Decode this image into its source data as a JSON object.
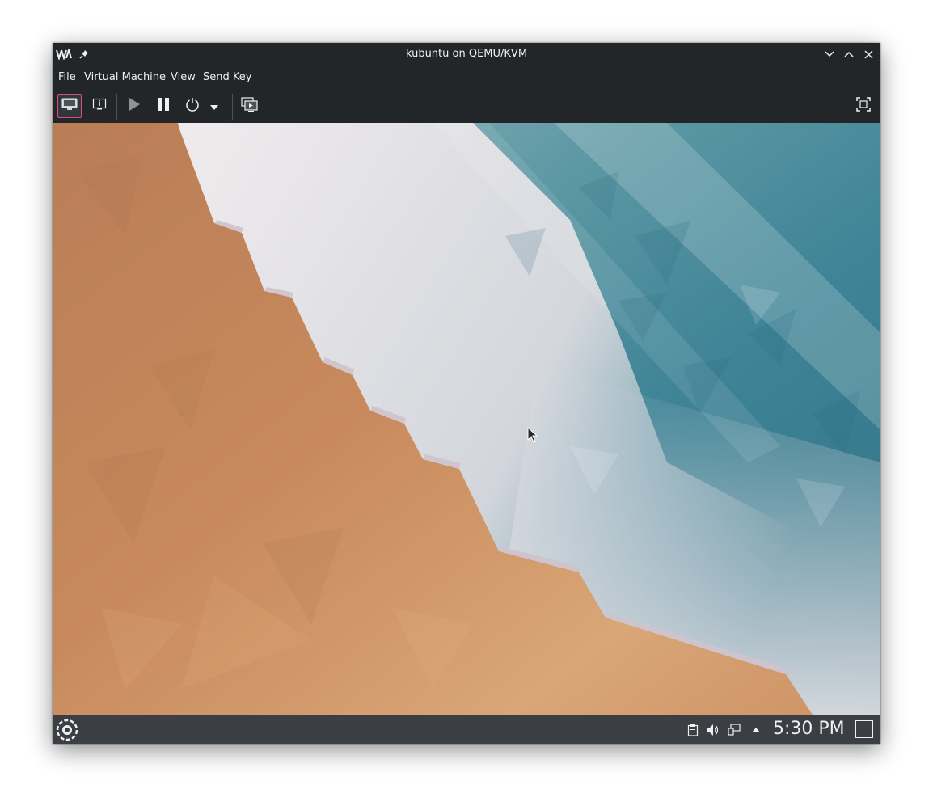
{
  "window": {
    "title": "kubuntu on QEMU/KVM",
    "app_icon": "virt-manager-icon",
    "pin_icon": "pin-icon",
    "controls": [
      "minimize-icon",
      "maximize-icon",
      "close-icon"
    ]
  },
  "menu": {
    "items": [
      {
        "label": "File"
      },
      {
        "label": "Virtual Machine"
      },
      {
        "label": "View"
      },
      {
        "label": "Send Key"
      }
    ]
  },
  "toolbar": {
    "buttons": [
      {
        "icon": "console-icon",
        "active": true
      },
      {
        "icon": "details-icon",
        "active": false
      },
      {
        "icon": "run-icon",
        "active": false
      },
      {
        "icon": "pause-icon",
        "active": false
      },
      {
        "icon": "power-icon",
        "active": false
      },
      {
        "icon": "dropdown-arrow-icon",
        "active": false
      },
      {
        "icon": "snapshots-icon",
        "active": false
      },
      {
        "icon": "fullscreen-icon",
        "active": false
      }
    ]
  },
  "guest_panel": {
    "launcher_icon": "kde-launcher-icon",
    "tray_icons": [
      "clipboard-icon",
      "volume-icon",
      "network-icon",
      "tray-expand-icon"
    ],
    "clock": "5:30 PM",
    "show_desktop_icon": "show-desktop-icon"
  },
  "colors": {
    "chrome": "#232629",
    "panel": "#3b3e42",
    "accent": "#da4b84",
    "sand": "#c58758",
    "water": "#3f8497"
  }
}
